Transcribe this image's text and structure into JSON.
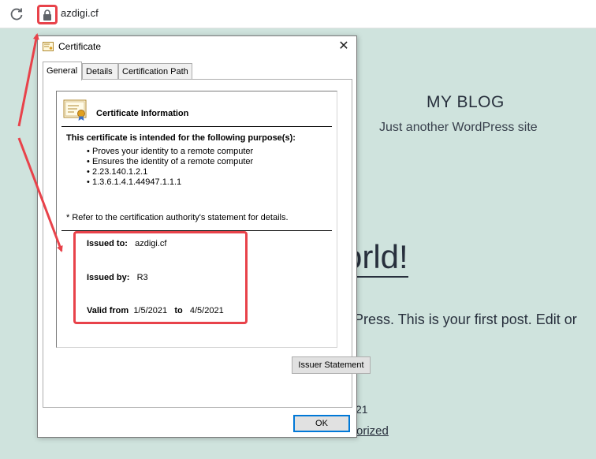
{
  "browser": {
    "url": "azdigi.cf"
  },
  "blog": {
    "title": "MY BLOG",
    "tagline": "Just another WordPress site",
    "post_title_visible": "orld!",
    "post_excerpt_visible": "Press. This is your first post. Edit or",
    "post_date_visible": "21",
    "post_category_visible": "orized"
  },
  "dialog": {
    "title": "Certificate",
    "close_label": "✕",
    "tabs": [
      {
        "label": "General",
        "active": true
      },
      {
        "label": "Details",
        "active": false
      },
      {
        "label": "Certification Path",
        "active": false
      }
    ],
    "info_heading": "Certificate Information",
    "purpose_heading": "This certificate is intended for the following purpose(s):",
    "purposes": [
      "Proves your identity to a remote computer",
      "Ensures the identity of a remote computer",
      "2.23.140.1.2.1",
      "1.3.6.1.4.1.44947.1.1.1"
    ],
    "refer_note": "* Refer to the certification authority's statement for details.",
    "issued_to_label": "Issued to:",
    "issued_to_value": "azdigi.cf",
    "issued_by_label": "Issued by:",
    "issued_by_value": "R3",
    "valid_from_label": "Valid from",
    "valid_from_value": "1/5/2021",
    "valid_to_label": "to",
    "valid_to_value": "4/5/2021",
    "issuer_statement_label": "Issuer Statement",
    "ok_label": "OK"
  },
  "colors": {
    "annotation_red": "#e8424a",
    "page_background": "#cfe3dd",
    "ok_focus": "#0078d7"
  }
}
